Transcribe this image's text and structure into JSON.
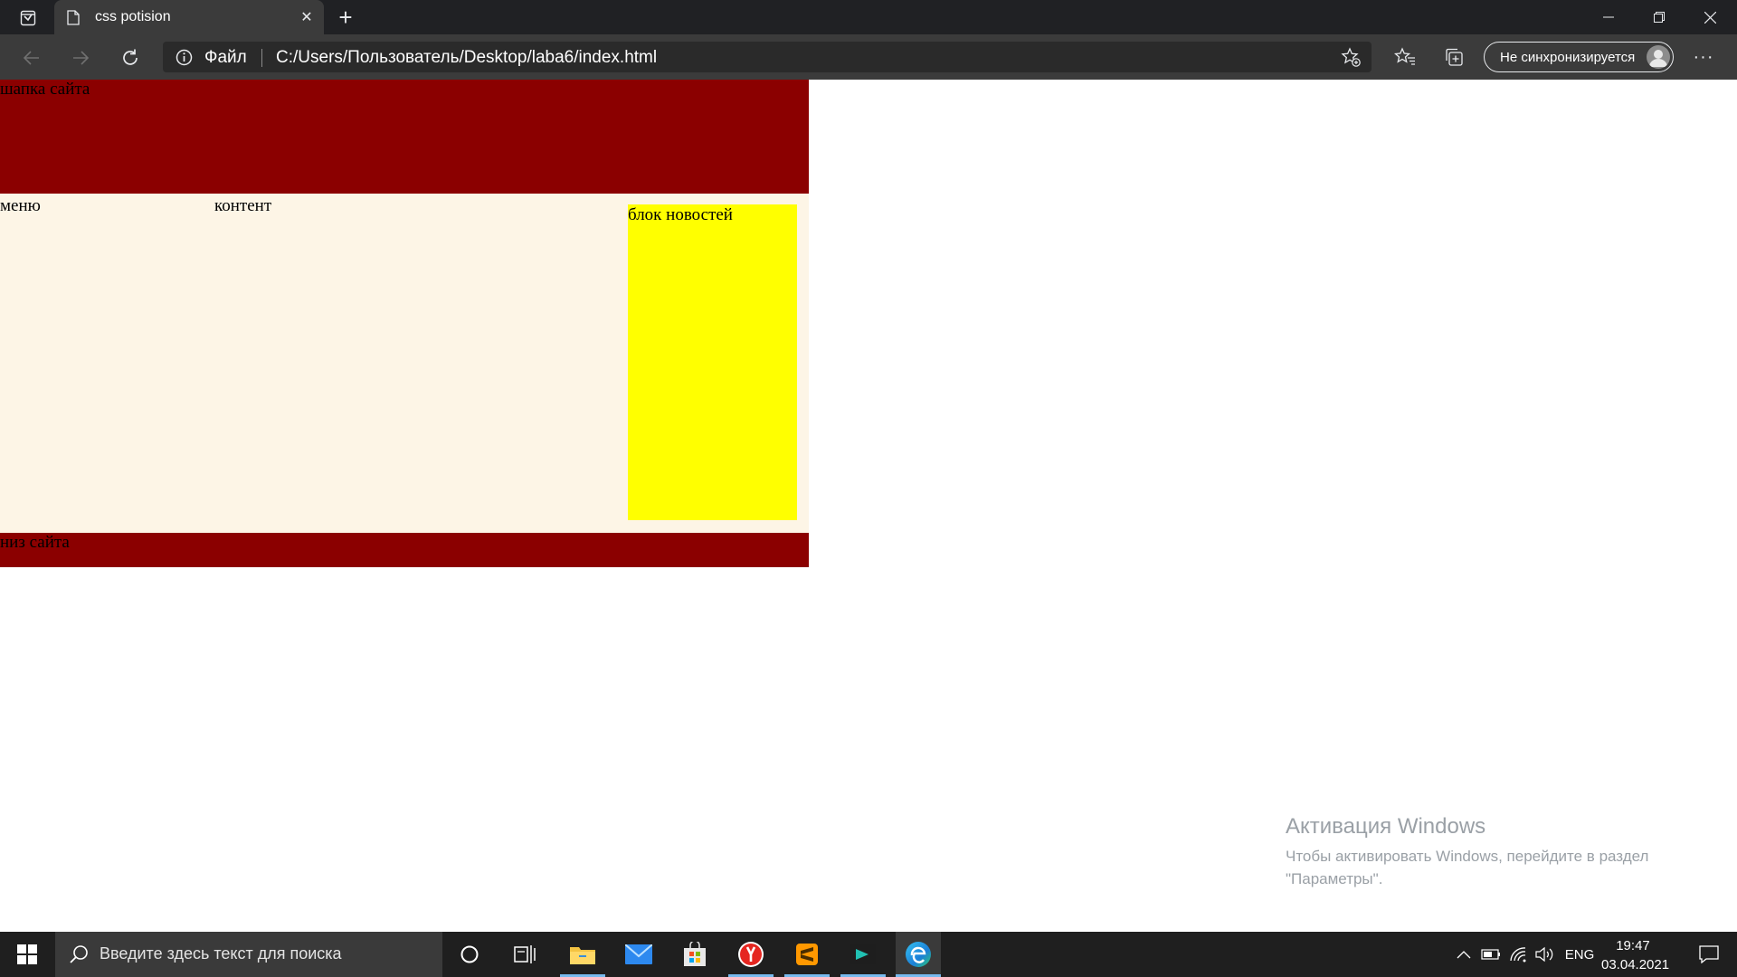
{
  "browser": {
    "tab_title": "css potision",
    "new_tab": "+",
    "address_scheme": "Файл",
    "address_url": "C:/Users/Пользователь/Desktop/laba6/index.html",
    "sync_label": "Не синхронизируется",
    "more": "···"
  },
  "page": {
    "header_text": "шапка сайта",
    "menu_text": "меню",
    "content_text": "контент",
    "news_text": "блок новостей",
    "footer_text": "низ сайта"
  },
  "colors": {
    "header_bg": "#8b0000",
    "middle_bg": "#fdf5e6",
    "news_bg": "#ffff00",
    "footer_bg": "#8b0000"
  },
  "watermark": {
    "title": "Активация Windows",
    "line1": "Чтобы активировать Windows, перейдите в раздел",
    "line2": "\"Параметры\"."
  },
  "taskbar": {
    "search_placeholder": "Введите здесь текст для поиска",
    "apps": [
      "cortana-icon",
      "task-view-icon",
      "file-explorer-icon",
      "mail-icon",
      "store-icon",
      "yandex-browser-icon",
      "sublime-text-icon",
      "terminal-icon",
      "edge-icon"
    ],
    "language": "ENG",
    "time": "19:47",
    "date": "03.04.2021"
  }
}
